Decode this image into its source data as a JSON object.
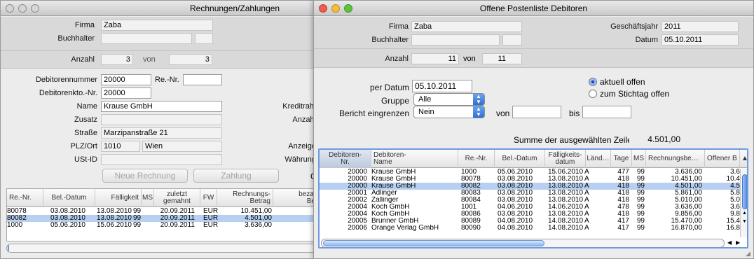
{
  "window_left": {
    "title": "Rechnungen/Zahlungen",
    "header": {
      "firma_label": "Firma",
      "firma_value": "Zaba",
      "buchhalter_label": "Buchhalter",
      "anzahl_label": "Anzahl",
      "anzahl_value": "3",
      "von_label": "von",
      "von_value": "3"
    },
    "form": {
      "debitorennummer_label": "Debitorennummer",
      "debitorennummer_value": "20000",
      "renr_label": "Re.-Nr.",
      "renr_value": "",
      "debitorenkto_label": "Debitorenkto.-Nr.",
      "debitorenkto_value": "20000",
      "name_label": "Name",
      "name_value": "Krause GmbH",
      "zusatz_label": "Zusatz",
      "zusatz_value": "",
      "strasse_label": "Straße",
      "strasse_value": "Marzipanstraße 21",
      "plzort_label": "PLZ/Ort",
      "plz_value": "1010",
      "ort_value": "Wien",
      "ustid_label": "USt-ID",
      "ustid_value": "",
      "kreditrahmen_label": "Kreditrahı",
      "anzahl2_label": "Anzahl",
      "anzeige_label": "Anzeige",
      "waehrung_label": "Währung"
    },
    "buttons": {
      "neue_rechnung": "Neue Rechnung",
      "zahlung": "Zahlung",
      "o_label": "O"
    },
    "table": {
      "headers": [
        "Re.-Nr.",
        "Bel.-Datum",
        "Fälligkeit",
        "MS",
        "zuletzt gemahnt",
        "FW",
        "Rechnungs-\nBetrag",
        "bezal\nBe"
      ],
      "rows": [
        [
          "80078",
          "03.08.2010",
          "13.08.2010",
          "99",
          "20.09.2011",
          "EUR",
          "10.451,00"
        ],
        [
          "80082",
          "03.08.2010",
          "13.08.2010",
          "99",
          "20.09.2011",
          "EUR",
          "4.501,00"
        ],
        [
          "1000",
          "05.06.2010",
          "15.06.2010",
          "99",
          "20.09.2011",
          "EUR",
          "3.636,00"
        ]
      ],
      "selected_row": 1
    }
  },
  "window_right": {
    "title": "Offene Postenliste Debitoren",
    "header": {
      "firma_label": "Firma",
      "firma_value": "Zaba",
      "buchhalter_label": "Buchhalter",
      "geschaeftsjahr_label": "Geschäftsjahr",
      "geschaeftsjahr_value": "2011",
      "datum_label": "Datum",
      "datum_value": "05.10.2011",
      "anzahl_label": "Anzahl",
      "anzahl_value": "11",
      "von_label": "von",
      "von_value": "11"
    },
    "filter": {
      "perdatum_label": "per Datum",
      "perdatum_value": "05.10.2011",
      "gruppe_label": "Gruppe",
      "gruppe_value": "Alle",
      "bericht_label": "Bericht eingrenzen",
      "bericht_value": "Nein",
      "von_label": "von",
      "bis_label": "bis",
      "radio_aktuell": "aktuell offen",
      "radio_stichtag": "zum Stichtag offen",
      "summe_label": "Summe der ausgewählten Zeilen",
      "summe_value": "4.501,00"
    },
    "table": {
      "headers": [
        "Debitoren-\nNr.",
        "Debitoren-\nName",
        "Re.-Nr.",
        "Bel.-Datum",
        "Fälligkeits-\ndatum",
        "Länd…",
        "Tage",
        "MS",
        "Rechnungsbe…",
        "Offener B"
      ],
      "rows": [
        [
          "20000",
          "Krause GmbH",
          "1000",
          "05.06.2010",
          "15.06.2010",
          "A",
          "477",
          "99",
          "3.636,00",
          "3.6"
        ],
        [
          "20000",
          "Krause GmbH",
          "80078",
          "03.08.2010",
          "13.08.2010",
          "A",
          "418",
          "99",
          "10.451,00",
          "10.4"
        ],
        [
          "20000",
          "Krause GmbH",
          "80082",
          "03.08.2010",
          "13.08.2010",
          "A",
          "418",
          "99",
          "4.501,00",
          "4.5"
        ],
        [
          "20001",
          "Adlinger",
          "80083",
          "03.08.2010",
          "13.08.2010",
          "A",
          "418",
          "99",
          "5.861,00",
          "5.8"
        ],
        [
          "20002",
          "Zallinger",
          "80084",
          "03.08.2010",
          "13.08.2010",
          "A",
          "418",
          "99",
          "5.010,00",
          "5.0"
        ],
        [
          "20004",
          "Koch GmbH",
          "1001",
          "04.06.2010",
          "14.06.2010",
          "A",
          "478",
          "99",
          "3.636,00",
          "3.6"
        ],
        [
          "20004",
          "Koch GmbH",
          "80086",
          "03.08.2010",
          "13.08.2010",
          "A",
          "418",
          "99",
          "9.856,00",
          "9.8"
        ],
        [
          "20005",
          "Brunner GmbH",
          "80089",
          "04.08.2010",
          "14.08.2010",
          "A",
          "417",
          "99",
          "15.470,00",
          "15.4"
        ],
        [
          "20006",
          "Orange Verlag GmbH",
          "80090",
          "04.08.2010",
          "14.08.2010",
          "A",
          "417",
          "99",
          "16.870,00",
          "16.8"
        ]
      ],
      "selected_row": 2
    }
  },
  "colors": {
    "selection": "#b7cff0",
    "accent": "#2e6fd6"
  }
}
